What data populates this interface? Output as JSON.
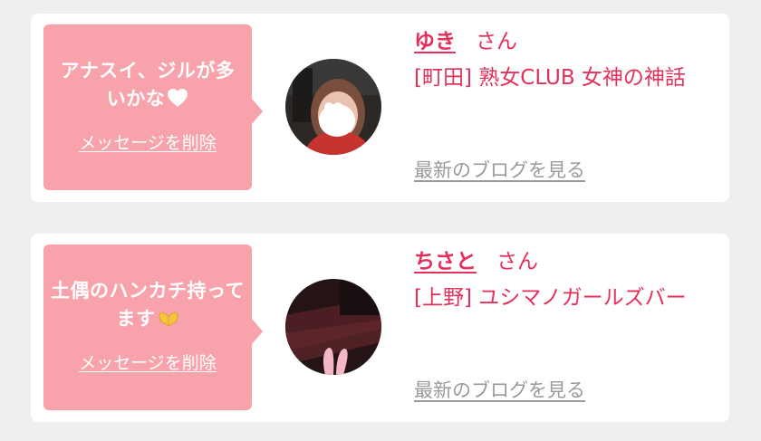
{
  "messages": [
    {
      "bubble_text": "アナスイ、ジルが多いかな",
      "bubble_emoji": "heart-emoji",
      "delete_label": "メッセージを削除",
      "name": "ゆき",
      "honorific": "さん",
      "shop": "[町田] 熟女CLUB 女神の神話",
      "blog_label": "最新のブログを見る"
    },
    {
      "bubble_text": "土偶のハンカチ持ってます",
      "bubble_emoji": "heart-hands-emoji",
      "delete_label": "メッセージを削除",
      "name": "ちさと",
      "honorific": "さん",
      "shop": "[上野] ユシマノガールズバー",
      "blog_label": "最新のブログを見る"
    }
  ],
  "colors": {
    "bubble": "#f8a2ac",
    "accent": "#e4305a",
    "link_gray": "#9a9a9a",
    "background": "#efefef"
  }
}
